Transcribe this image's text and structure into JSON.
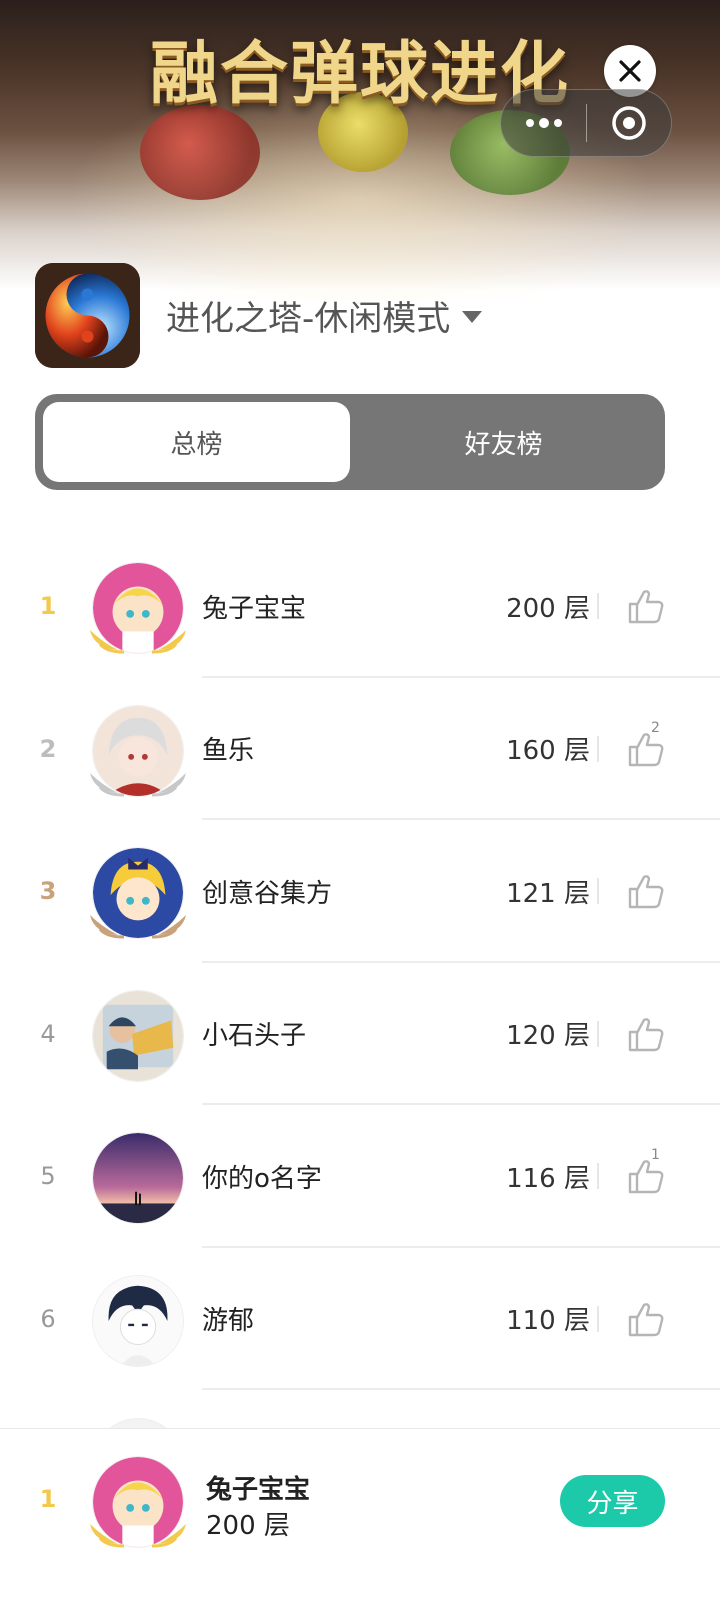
{
  "banner": {
    "title": "融合弹球进化"
  },
  "capsule": {
    "more_icon": "more-dots-icon",
    "target_icon": "target-icon",
    "close_icon": "close-icon"
  },
  "header": {
    "mode_label": "进化之塔-休闲模式",
    "game_icon": "yin-yang-fire-ice-icon"
  },
  "tabs": [
    {
      "label": "总榜",
      "active": true
    },
    {
      "label": "好友榜",
      "active": false
    }
  ],
  "colors": {
    "gold": "#f2c94c",
    "silver": "#bdbdbd",
    "bronze": "#c8a27a",
    "accent": "#1cc9a9",
    "tab_bg": "#767676"
  },
  "leaderboard": [
    {
      "rank": "1",
      "name": "兔子宝宝",
      "score": "200 层",
      "likes": "",
      "avatar": "pink-anime-avatar",
      "medal": "gold"
    },
    {
      "rank": "2",
      "name": "鱼乐",
      "score": "160 层",
      "likes": "2",
      "avatar": "white-hair-anime-avatar",
      "medal": "silver"
    },
    {
      "rank": "3",
      "name": "创意谷集方",
      "score": "121 层",
      "likes": "",
      "avatar": "blue-anime-avatar",
      "medal": "bronze"
    },
    {
      "rank": "4",
      "name": "小石头子",
      "score": "120 层",
      "likes": "",
      "avatar": "child-photo-avatar",
      "medal": ""
    },
    {
      "rank": "5",
      "name": "你的o名字",
      "score": "116 层",
      "likes": "1",
      "avatar": "sunset-sky-avatar",
      "medal": ""
    },
    {
      "rank": "6",
      "name": "游郁",
      "score": "110 层",
      "likes": "",
      "avatar": "sketch-boy-avatar",
      "medal": ""
    }
  ],
  "me": {
    "rank": "1",
    "name": "兔子宝宝",
    "score": "200 层",
    "share_label": "分享",
    "avatar": "pink-anime-avatar"
  }
}
